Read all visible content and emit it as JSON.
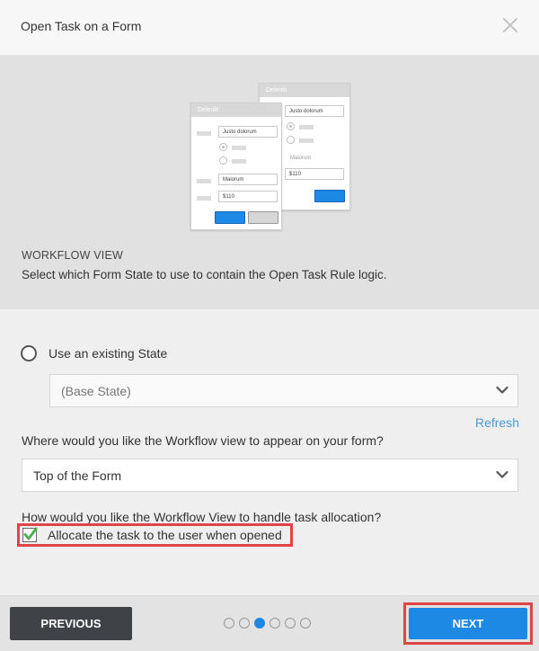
{
  "dialog": {
    "title": "Open Task on a Form"
  },
  "hero": {
    "heading": "WORKFLOW VIEW",
    "description": "Select which Form State to use to contain the Open Task Rule logic.",
    "illustration": {
      "back_card_title": "Delenlti",
      "front_card_title": "Delenlti",
      "input_text": "Justo dolorum",
      "secondary_text": "Maiorum",
      "amount": "$110",
      "accent": "#1e88e5"
    }
  },
  "state_option": {
    "label": "Use an existing State",
    "select_value": "(Base State)",
    "refresh_label": "Refresh"
  },
  "position": {
    "question": "Where would you like the Workflow view to appear on your form?",
    "select_value": "Top of the Form"
  },
  "allocation": {
    "question": "How would you like the Workflow View to handle task allocation?",
    "checkbox_label": "Allocate the task to the user when opened",
    "checked": true
  },
  "footer": {
    "previous_label": "PREVIOUS",
    "next_label": "NEXT",
    "step_count": 6,
    "current_step": 3
  },
  "colors": {
    "primary": "#1e88e5",
    "highlight": "#e04545",
    "check": "#4caf50"
  }
}
